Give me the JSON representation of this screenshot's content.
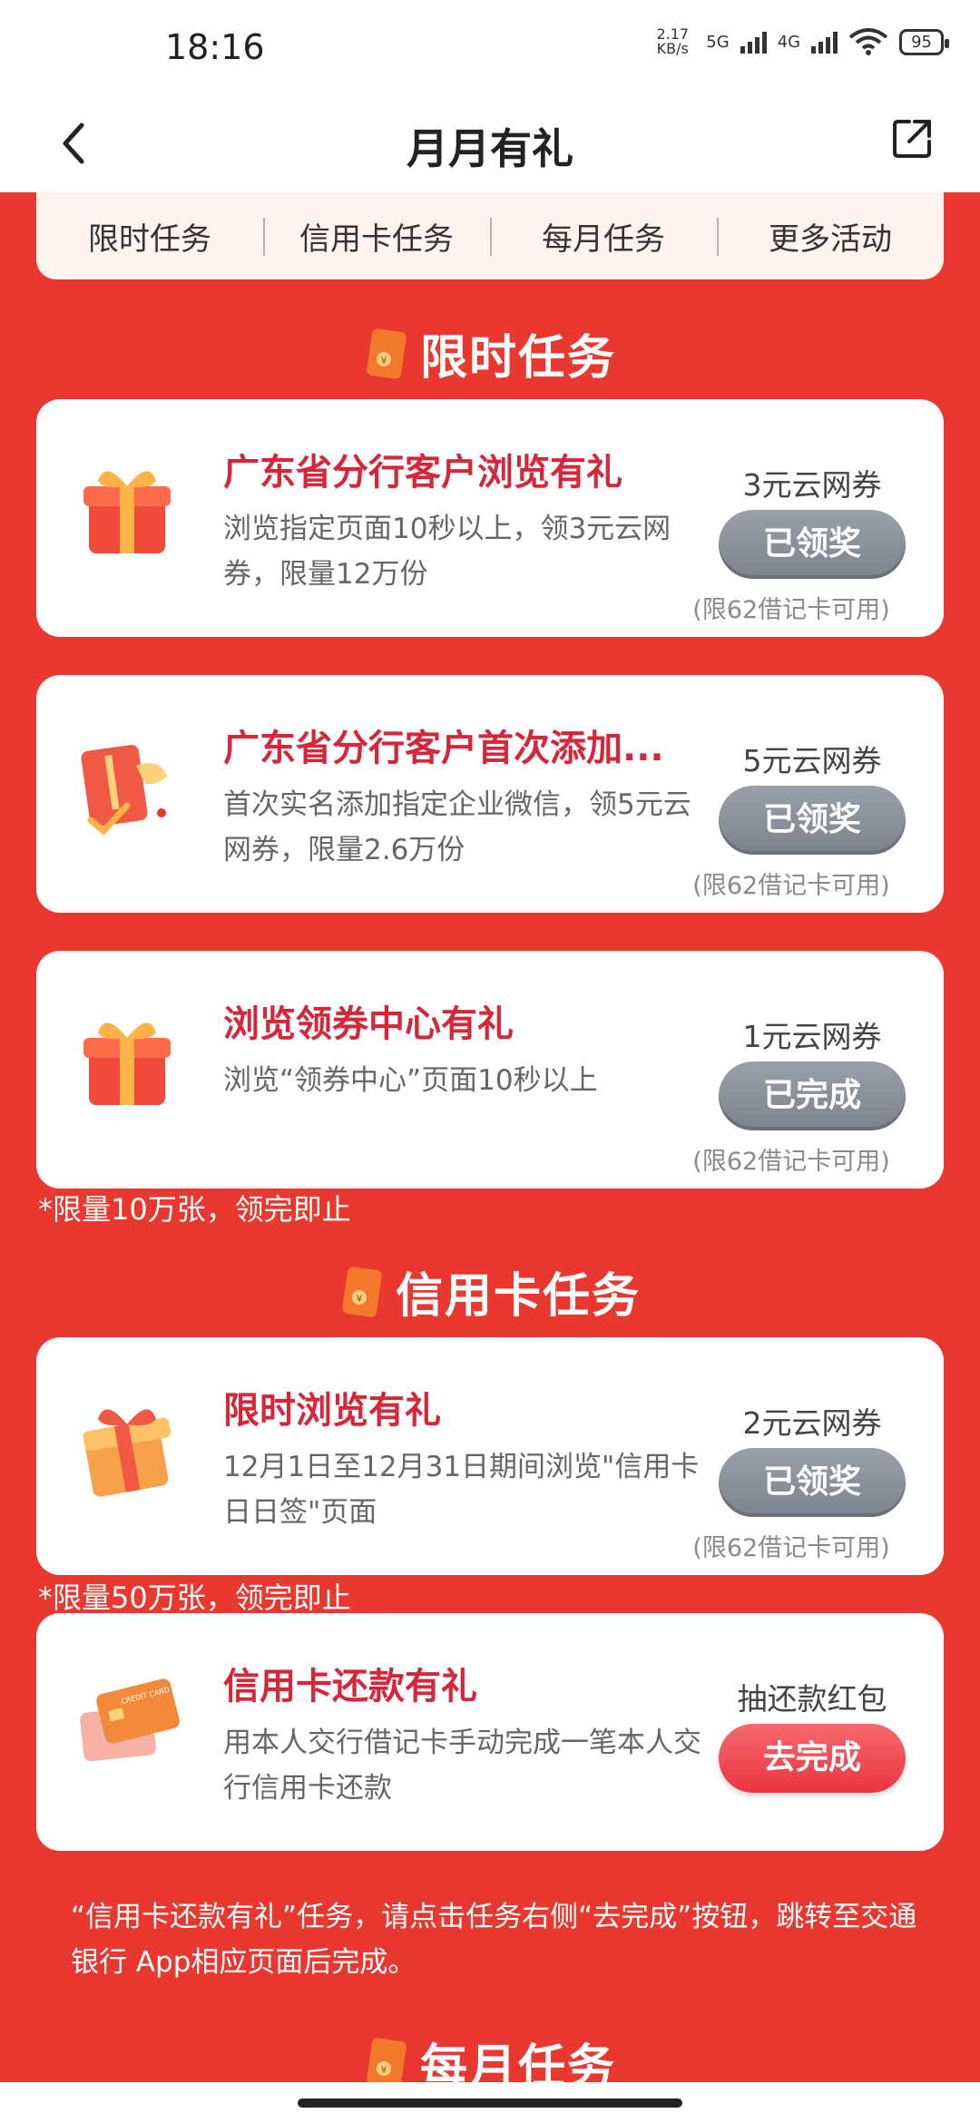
{
  "status_bar": {
    "time": "18:16",
    "net_speed": "2.17\nKB/s",
    "sim1": "5G",
    "sim2": "4G",
    "battery": "95"
  },
  "header": {
    "title": "月月有礼",
    "back_icon": "chevron-left-icon",
    "share_icon": "share-icon"
  },
  "tabs": [
    "限时任务",
    "信用卡任务",
    "每月任务",
    "更多活动"
  ],
  "sections": {
    "limited": "限时任务",
    "credit": "信用卡任务",
    "monthly": "每月任务"
  },
  "cards": [
    {
      "name": "广东省分行客户浏览有礼",
      "desc": "浏览指定页面10秒以上，领3元云网券，限量12万份",
      "reward": "3元云网券",
      "button": "已领奖",
      "note": "(限62借记卡可用)",
      "icon": "gift-icon"
    },
    {
      "name": "广东省分行客户首次添加...",
      "desc": "首次实名添加指定企业微信，领5元云网券，限量2.6万份",
      "reward": "5元云网券",
      "button": "已领奖",
      "note": "(限62借记卡可用)",
      "icon": "card-receipt-icon"
    },
    {
      "name": "浏览领券中心有礼",
      "desc": "浏览“领券中心”页面10秒以上",
      "reward": "1元云网券",
      "button": "已完成",
      "note": "(限62借记卡可用)",
      "icon": "gift-icon"
    },
    {
      "name": "限时浏览有礼",
      "desc": "12月1日至12月31日期间浏览\"信用卡日日签\"页面",
      "reward": "2元云网券",
      "button": "已领奖",
      "note": "(限62借记卡可用)",
      "icon": "gift-icon"
    },
    {
      "name": "信用卡还款有礼",
      "desc": "用本人交行借记卡手动完成一笔本人交行信用卡还款",
      "reward": "抽还款红包",
      "button": "去完成",
      "icon": "credit-card-icon"
    }
  ],
  "limits": {
    "limited_section": "*限量10万张，领完即止",
    "credit_card_1": "*限量50万张，领完即止"
  },
  "footnote": "“信用卡还款有礼”任务，请点击任务右侧“去完成”按钮，跳转至交通银行 App相应页面后完成。",
  "credit_card_label": "CREDIT CARD",
  "colors": {
    "background": "#e8382f",
    "title_red": "#d5263a",
    "button_grey": "#8a9099",
    "button_red": "#ea3440"
  }
}
